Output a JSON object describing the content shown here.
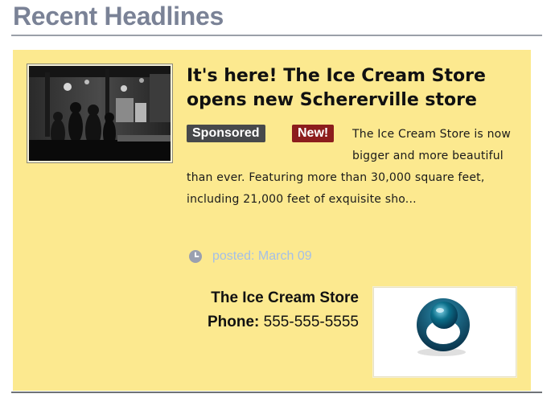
{
  "section": {
    "title": "Recent Headlines"
  },
  "article": {
    "image_alt": "Dimly lit cafe interior with people",
    "headline": "It's here! The Ice Cream Store opens new Schererville store",
    "badges": {
      "sponsored": "Sponsored",
      "new": "New!"
    },
    "summary": "The Ice Cream Store is now bigger and more beautiful than ever. Featuring more than 30,000 square feet, including 21,000 feet of exquisite sho...",
    "posted": "posted: March 09",
    "posted_icon": "clock-icon"
  },
  "business": {
    "name": "The Ice Cream Store",
    "phone_label": "Phone:",
    "phone": "555-555-5555",
    "logo_icon": "sphere-logo"
  },
  "colors": {
    "card_background": "#fce98f",
    "title_color": "#7a8296",
    "sponsored_badge": "#47494b",
    "new_badge": "#8c1d1d",
    "posted_text": "#a4bfe8",
    "logo_teal": "#0b6f8a"
  }
}
